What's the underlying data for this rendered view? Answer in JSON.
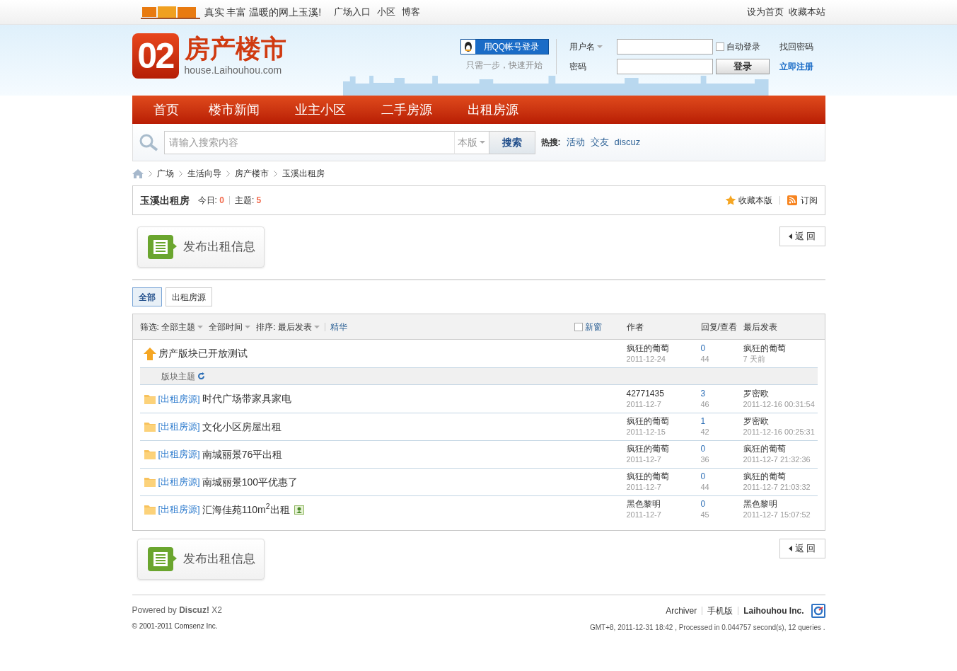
{
  "topbar": {
    "slogan": "真实 丰富 温暖的网上玉溪!",
    "links": [
      "广场入口",
      "小区",
      "博客"
    ],
    "right_links": [
      "设为首页",
      "收藏本站"
    ]
  },
  "header": {
    "logo_number": "02",
    "logo_title": "房产楼市",
    "logo_domain": "house.Laihouhou.com",
    "qq_login": "用QQ帐号登录",
    "qq_hint": "只需一步，快速开始",
    "username_label": "用户名",
    "password_label": "密码",
    "auto_login": {
      "label": "自动登录",
      "checked": false
    },
    "login_button": "登录",
    "forgot": "找回密码",
    "register": "立即注册"
  },
  "nav": [
    {
      "label": "首页"
    },
    {
      "label": "楼市新闻"
    },
    {
      "label": "业主小区"
    },
    {
      "label": "二手房源"
    },
    {
      "label": "出租房源"
    }
  ],
  "search": {
    "placeholder": "请输入搜索内容",
    "scope": "本版",
    "button": "搜索",
    "hot_label": "热搜:",
    "hot": [
      "活动",
      "交友",
      "discuz"
    ]
  },
  "breadcrumb": [
    "广场",
    "生活向导",
    "房产楼市",
    "玉溪出租房"
  ],
  "forum": {
    "title": "玉溪出租房",
    "today_label": "今日:",
    "today": "0",
    "topics_label": "主题:",
    "topics": "5",
    "favorite": "收藏本版",
    "subscribe": "订阅"
  },
  "top_actions": {
    "post_button": "发布出租信息",
    "back_button": "返 回"
  },
  "bottom_actions": {
    "post_button": "发布出租信息",
    "back_button": "返 回"
  },
  "tabs": [
    {
      "label": "全部",
      "selected": true
    },
    {
      "label": "出租房源",
      "selected": false
    }
  ],
  "filter": {
    "filter_label": "筛选:",
    "filter_value": "全部主题",
    "time": "全部时间",
    "sort_label": "排序:",
    "sort_value": "最后发表",
    "digest": "精华",
    "new_window": {
      "label": "新窗",
      "checked": false
    },
    "col_author": "作者",
    "col_replies": "回复/查看",
    "col_last": "最后发表"
  },
  "separator": "版块主题",
  "threads": [
    {
      "kind": "sticky",
      "title": "房产版块已开放测试",
      "author": "疯狂的葡萄",
      "date": "2011-12-24",
      "replies": "0",
      "views": "44",
      "last_user": "疯狂的葡萄",
      "last_time": "7 天前"
    },
    {
      "kind": "normal",
      "type": "[出租房源]",
      "title": "时代广场带家具家电",
      "author": "42771435",
      "date": "2011-12-7",
      "replies": "3",
      "views": "46",
      "last_user": "罗密欧",
      "last_time": "2011-12-16 00:31:54"
    },
    {
      "kind": "normal",
      "type": "[出租房源]",
      "title": "文化小区房屋出租",
      "author": "疯狂的葡萄",
      "date": "2011-12-15",
      "replies": "1",
      "views": "42",
      "last_user": "罗密欧",
      "last_time": "2011-12-16 00:25:31"
    },
    {
      "kind": "normal",
      "type": "[出租房源]",
      "title": "南城丽景76平出租",
      "author": "疯狂的葡萄",
      "date": "2011-12-7",
      "replies": "0",
      "views": "36",
      "last_user": "疯狂的葡萄",
      "last_time": "2011-12-7 21:32:36"
    },
    {
      "kind": "normal",
      "type": "[出租房源]",
      "title": "南城丽景100平优惠了",
      "author": "疯狂的葡萄",
      "date": "2011-12-7",
      "replies": "0",
      "views": "44",
      "last_user": "疯狂的葡萄",
      "last_time": "2011-12-7 21:03:32"
    },
    {
      "kind": "normal",
      "type": "[出租房源]",
      "title": "汇海佳苑110m$^{2}$出租",
      "has_image": true,
      "author": "黑色黎明",
      "date": "2011-12-7",
      "replies": "0",
      "views": "45",
      "last_user": "黑色黎明",
      "last_time": "2011-12-7 15:07:52"
    }
  ],
  "footer": {
    "powered_by": "Powered by **Discuz!** X2",
    "copyright": "© 2001-2011 Comsenz Inc.",
    "links": [
      "Archiver",
      "手机版"
    ],
    "company": "Laihouhou Inc.",
    "stats": "GMT+8, 2011-12-31 18:42 , Processed in 0.044757 second(s), 12 queries ."
  }
}
